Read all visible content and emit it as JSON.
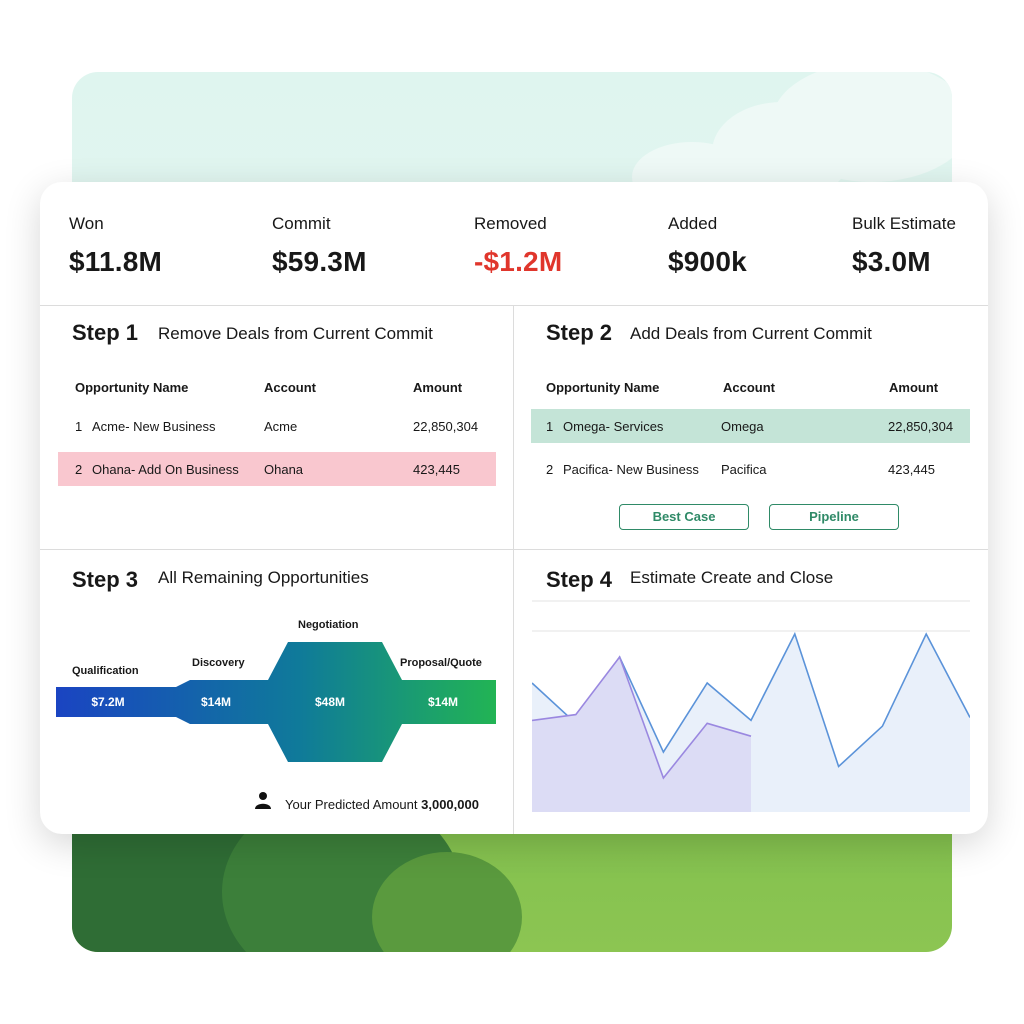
{
  "metrics": [
    {
      "label": "Won",
      "value": "$11.8M"
    },
    {
      "label": "Commit",
      "value": "$59.3M"
    },
    {
      "label": "Removed",
      "value": "-$1.2M"
    },
    {
      "label": "Added",
      "value": "$900k"
    },
    {
      "label": "Bulk Estimate",
      "value": "$3.0M"
    }
  ],
  "step1": {
    "title": "Step 1",
    "subtitle": "Remove Deals from Current Commit",
    "headers": [
      "Opportunity Name",
      "Account",
      "Amount"
    ],
    "rows": [
      {
        "num": "1",
        "name": "Acme- New Business",
        "account": "Acme",
        "amount": "22,850,304"
      },
      {
        "num": "2",
        "name": "Ohana- Add On Business",
        "account": "Ohana",
        "amount": "423,445"
      }
    ],
    "highlight_color": "#f9c7cf"
  },
  "step2": {
    "title": "Step 2",
    "subtitle": "Add Deals from Current Commit",
    "headers": [
      "Opportunity Name",
      "Account",
      "Amount"
    ],
    "rows": [
      {
        "num": "1",
        "name": "Omega- Services",
        "account": "Omega",
        "amount": "22,850,304"
      },
      {
        "num": "2",
        "name": "Pacifica- New Business",
        "account": "Pacifica",
        "amount": "423,445"
      }
    ],
    "highlight_color": "#c4e4d7",
    "buttons": [
      "Best Case",
      "Pipeline"
    ]
  },
  "step3": {
    "title": "Step 3",
    "subtitle": "All Remaining Opportunities",
    "stages": [
      {
        "label": "Qualification",
        "value": "$7.2M"
      },
      {
        "label": "Discovery",
        "value": "$14M"
      },
      {
        "label": "Negotiation",
        "value": "$48M"
      },
      {
        "label": "Proposal/Quote",
        "value": "$14M"
      }
    ],
    "predicted_label": "Your Predicted Amount",
    "predicted_value": "3,000,000"
  },
  "step4": {
    "title": "Step 4",
    "subtitle": "Estimate Create and Close"
  },
  "chart_data": {
    "type": "area",
    "series": [
      {
        "values": [
          66,
          38,
          84,
          18,
          66,
          40,
          100,
          8,
          36,
          100,
          42
        ]
      },
      {
        "values": [
          40,
          44,
          84,
          0,
          38,
          29
        ]
      }
    ],
    "ylim": [
      0,
      100
    ],
    "grid": true
  },
  "colors": {
    "accent_green": "#2f8a67",
    "negative_red": "#e0362c",
    "funnel_start": "#1a44c2",
    "funnel_end": "#22b454"
  }
}
